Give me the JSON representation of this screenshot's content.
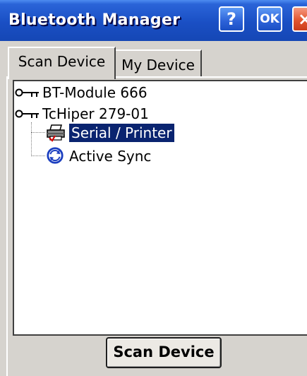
{
  "window": {
    "title": "Bluetooth Manager",
    "help_label": "?",
    "ok_label": "OK",
    "close_label": "×"
  },
  "tabs": [
    {
      "label": "Scan Device",
      "active": true
    },
    {
      "label": "My Device",
      "active": false
    }
  ],
  "tree": {
    "devices": [
      {
        "label": "BT-Module 666",
        "icon": "key-icon"
      },
      {
        "label": "TcHiper 279-01",
        "icon": "key-icon",
        "services": [
          {
            "label": "Serial / Printer",
            "icon": "printer-icon",
            "selected": true
          },
          {
            "label": "Active Sync",
            "icon": "activesync-icon",
            "selected": false
          }
        ]
      }
    ]
  },
  "footer": {
    "scan_button_label": "Scan Device"
  },
  "colors": {
    "title_bar": "#1a4fc4",
    "close_button": "#e2552f",
    "selection": "#0a2470",
    "window_bg": "#d6d3ce"
  }
}
